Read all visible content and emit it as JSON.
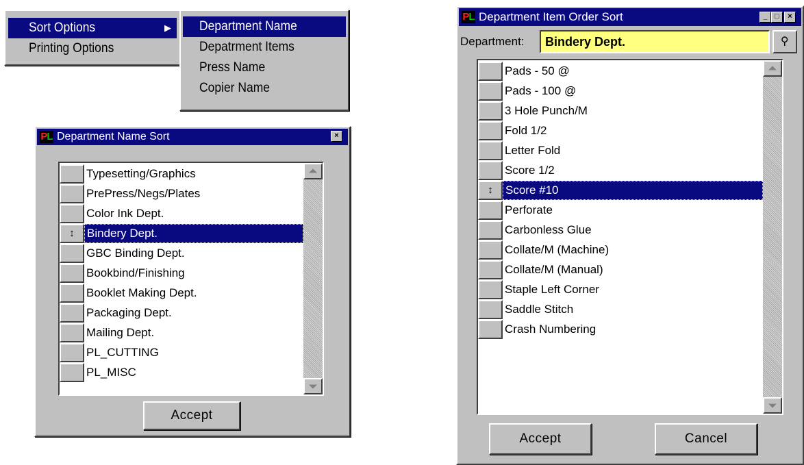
{
  "main_menu": {
    "items": [
      {
        "label": "Sort Options",
        "arrow": "▶"
      },
      {
        "label": "Printing Options"
      }
    ]
  },
  "sort_submenu": {
    "items": [
      {
        "label": "Department Name"
      },
      {
        "label": "Depatrment Items"
      },
      {
        "label": "Press Name"
      },
      {
        "label": "Copier Name"
      }
    ]
  },
  "dept_name_sort": {
    "logo": {
      "p": "P",
      "l": "L"
    },
    "title": "Department Name Sort",
    "close_glyph": "×",
    "rows": [
      {
        "label": "Typesetting/Graphics",
        "handle": ""
      },
      {
        "label": "PrePress/Negs/Plates",
        "handle": ""
      },
      {
        "label": "Color Ink Dept.",
        "handle": ""
      },
      {
        "label": "Bindery Dept.",
        "handle": "↕"
      },
      {
        "label": "GBC Binding Dept.",
        "handle": ""
      },
      {
        "label": "Bookbind/Finishing",
        "handle": ""
      },
      {
        "label": "Booklet Making Dept.",
        "handle": ""
      },
      {
        "label": "Packaging Dept.",
        "handle": ""
      },
      {
        "label": "Mailing Dept.",
        "handle": ""
      },
      {
        "label": "PL_CUTTING",
        "handle": ""
      },
      {
        "label": "PL_MISC",
        "handle": ""
      }
    ],
    "accept_label": "Accept"
  },
  "dept_item_sort": {
    "logo": {
      "p": "P",
      "l": "L"
    },
    "title": "Department Item Order Sort",
    "titlebar_glyphs": {
      "minimize": "_",
      "maximize": "□",
      "close": "×"
    },
    "department_label": "Department:",
    "department_value": "Bindery Dept.",
    "search_glyph": "⚲",
    "rows": [
      {
        "label": "Pads - 50 @",
        "handle": ""
      },
      {
        "label": "Pads - 100 @",
        "handle": ""
      },
      {
        "label": "3 Hole Punch/M",
        "handle": ""
      },
      {
        "label": "Fold 1/2",
        "handle": ""
      },
      {
        "label": "Letter Fold",
        "handle": ""
      },
      {
        "label": "Score 1/2",
        "handle": ""
      },
      {
        "label": "Score #10",
        "handle": "↕"
      },
      {
        "label": "Perforate",
        "handle": ""
      },
      {
        "label": "Carbonless Glue",
        "handle": ""
      },
      {
        "label": "Collate/M (Machine)",
        "handle": ""
      },
      {
        "label": "Collate/M (Manual)",
        "handle": ""
      },
      {
        "label": "Staple Left Corner",
        "handle": ""
      },
      {
        "label": "Saddle Stitch",
        "handle": ""
      },
      {
        "label": "Crash Numbering",
        "handle": ""
      }
    ],
    "accept_label": "Accept",
    "cancel_label": "Cancel"
  },
  "colors": {
    "selection": "#0a0a80",
    "face": "#c0c0c0",
    "department_field": "#ffff80"
  }
}
